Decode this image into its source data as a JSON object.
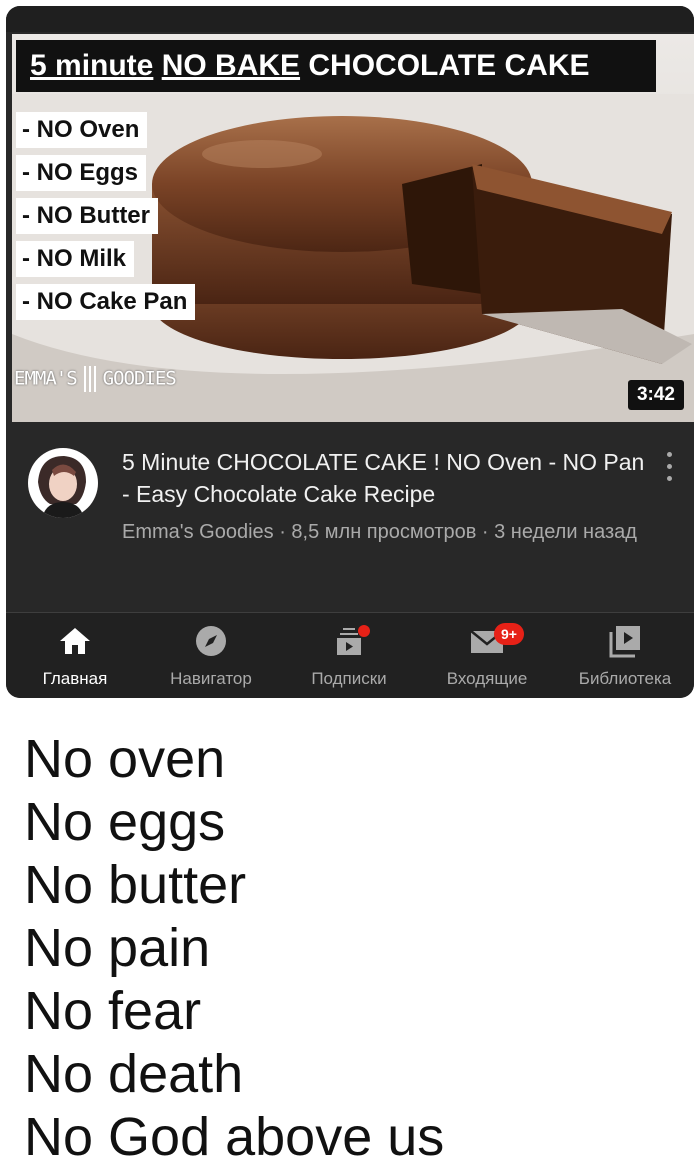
{
  "thumbnail": {
    "title_parts": [
      "5 minute",
      "NO BAKE",
      "CHOCOLATE CAKE"
    ],
    "tags": [
      "- NO Oven",
      "- NO Eggs",
      "- NO Butter",
      "- NO Milk",
      "- NO Cake Pan"
    ],
    "logo_left": "EMMA'S",
    "logo_right": "GOODIES",
    "duration": "3:42"
  },
  "video": {
    "title": "5 Minute CHOCOLATE CAKE ! NO Oven - NO Pan - Easy Chocolate Cake Recipe",
    "subtitle": "Emma's Goodies · 8,5 млн просмотров · 3 недели назад"
  },
  "nav": {
    "items": [
      {
        "label": "Главная",
        "icon": "home-icon"
      },
      {
        "label": "Навигатор",
        "icon": "compass-icon"
      },
      {
        "label": "Подписки",
        "icon": "subscriptions-icon"
      },
      {
        "label": "Входящие",
        "icon": "inbox-icon",
        "badge": "9+"
      },
      {
        "label": "Библиотека",
        "icon": "library-icon"
      }
    ]
  },
  "caption": {
    "lines": [
      "No oven",
      "No eggs",
      "No butter",
      "No pain",
      "No fear",
      "No death",
      "No God above us"
    ]
  },
  "colors": {
    "background": "#282828",
    "badge": "#e62117",
    "chocolate": "#6b3a22"
  }
}
